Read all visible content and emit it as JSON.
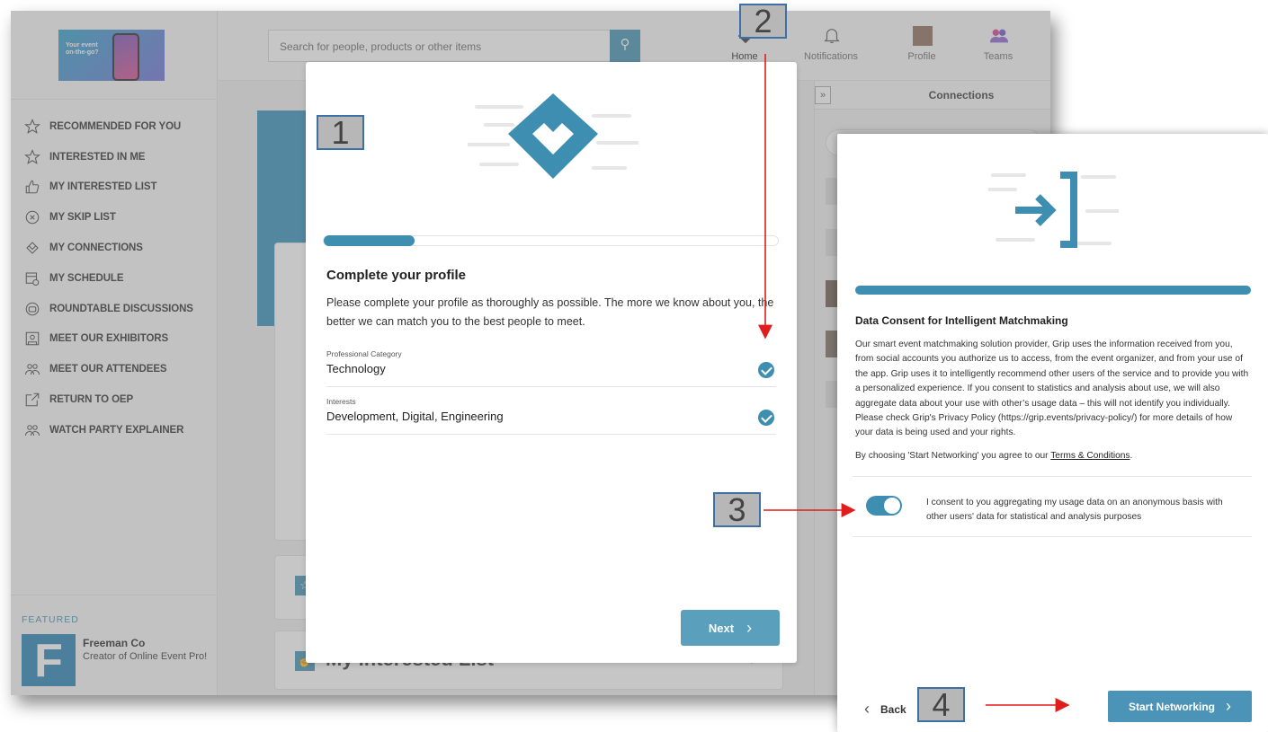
{
  "sidebar": {
    "logo_text": "Your event on-the-go?",
    "nav": [
      {
        "label": "RECOMMENDED FOR YOU",
        "icon": "star-icon"
      },
      {
        "label": "INTERESTED IN ME",
        "icon": "star-outline-icon"
      },
      {
        "label": "MY INTERESTED LIST",
        "icon": "thumbs-up-icon"
      },
      {
        "label": "MY SKIP LIST",
        "icon": "circle-x-icon"
      },
      {
        "label": "MY CONNECTIONS",
        "icon": "handshake-icon"
      },
      {
        "label": "MY SCHEDULE",
        "icon": "calendar-clock-icon"
      },
      {
        "label": "ROUNDTABLE DISCUSSIONS",
        "icon": "roundtable-icon"
      },
      {
        "label": "MEET OUR EXHIBITORS",
        "icon": "exhibitor-icon"
      },
      {
        "label": "MEET OUR ATTENDEES",
        "icon": "attendees-icon"
      },
      {
        "label": "RETURN TO OEP",
        "icon": "external-link-icon"
      },
      {
        "label": "WATCH PARTY EXPLAINER",
        "icon": "attendees-icon"
      }
    ],
    "featured_label": "FEATURED",
    "featured_logo_letter": "F",
    "featured_name": "Freeman Co",
    "featured_subtitle": "Creator of Online Event Pro!"
  },
  "header": {
    "search_placeholder": "Search for people, products or other items",
    "nav": [
      {
        "label": "Home",
        "icon": "handshake-icon"
      },
      {
        "label": "Notifications",
        "icon": "bell-icon"
      },
      {
        "label": "Profile",
        "icon": "profile-avatar"
      },
      {
        "label": "Teams",
        "icon": "teams-icon"
      }
    ]
  },
  "right_panel": {
    "expand": "»",
    "title": "Connections"
  },
  "background": {
    "card_title": "My Interested List",
    "card_chevron": "›"
  },
  "modal_profile": {
    "progress_fraction": 0.2,
    "title": "Complete your profile",
    "description": "Please complete your profile as thoroughly as possible. The more we know about you, the better we can match you to the best people to meet.",
    "fields": [
      {
        "label": "Professional Category",
        "value": "Technology"
      },
      {
        "label": "Interests",
        "value": "Development, Digital, Engineering"
      }
    ],
    "next_label": "Next",
    "next_chevron": "›"
  },
  "modal_consent": {
    "title": "Data Consent for Intelligent Matchmaking",
    "description": "Our smart event matchmaking solution provider, Grip uses the information received from you, from social accounts you authorize us to access, from the event organizer, and from your use of the app. Grip uses it to intelligently recommend other users of the service and to provide you with a personalized experience. If you consent to statistics and analysis about use, we will also aggregate data about your use with other’s usage data – this will not identify you individually. Please check Grip's Privacy Policy (https://grip.events/privacy-policy/) for more details of how your data is being used and your rights.",
    "agree_prefix": "By choosing 'Start Networking' you agree to our ",
    "agree_link": "Terms & Conditions",
    "agree_suffix": ".",
    "consent_text": "I consent to you aggregating my usage data on an anonymous basis with other users' data for statistical and analysis purposes",
    "toggle_on": true,
    "back_label": "Back",
    "back_chevron": "‹",
    "start_label": "Start Networking",
    "start_chevron": "›"
  },
  "steps": [
    "1",
    "2",
    "3",
    "4"
  ],
  "colors": {
    "accent": "#3d8eb0",
    "arrow": "#e11c1c",
    "step_bg": "#b7b7b7",
    "step_border": "#3e6fa5"
  }
}
